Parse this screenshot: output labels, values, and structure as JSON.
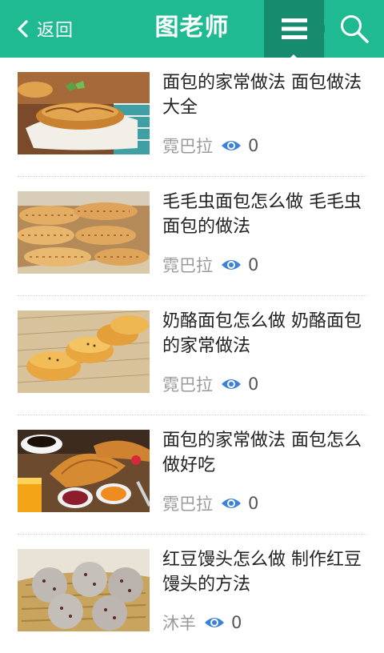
{
  "header": {
    "back_label": "返回",
    "title": "图老师",
    "menu_icon": "menu-icon",
    "search_icon": "search-icon",
    "brand_color": "#1fba92",
    "active_color": "#178b6d"
  },
  "articles": [
    {
      "title": "面包的家常做法 面包做法大全",
      "author": "霓巴拉",
      "views": "0"
    },
    {
      "title": "毛毛虫面包怎么做 毛毛虫面包的做法",
      "author": "霓巴拉",
      "views": "0"
    },
    {
      "title": "奶酪面包怎么做 奶酪面包的家常做法",
      "author": "霓巴拉",
      "views": "0"
    },
    {
      "title": "面包的家常做法 面包怎么做好吃",
      "author": "霓巴拉",
      "views": "0"
    },
    {
      "title": "红豆馒头怎么做 制作红豆馒头的方法",
      "author": "沐羊",
      "views": "0"
    }
  ]
}
